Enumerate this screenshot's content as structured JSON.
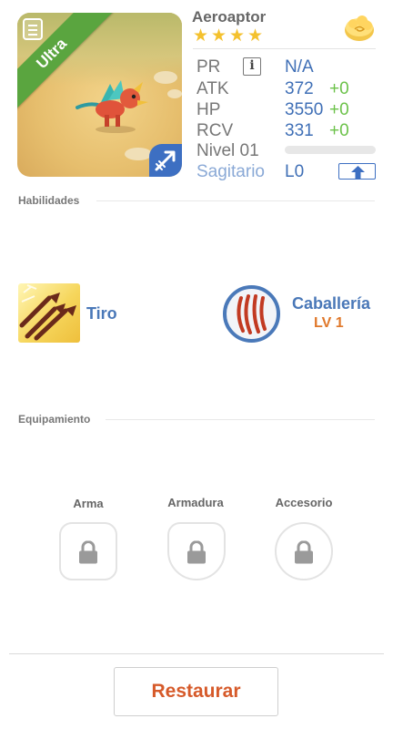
{
  "monster": {
    "name": "Aeroaptor",
    "rarity_badge": "Ultra",
    "stars": 4,
    "element": "Sagitario",
    "element_icon": "arrow-icon"
  },
  "stats": {
    "pr": {
      "label": "PR",
      "value": "N/A"
    },
    "atk": {
      "label": "ATK",
      "value": "372",
      "bonus": "+0"
    },
    "hp": {
      "label": "HP",
      "value": "3550",
      "bonus": "+0"
    },
    "rcv": {
      "label": "RCV",
      "value": "331",
      "bonus": "+0"
    },
    "level": {
      "label": "Nivel 01",
      "progress": 0
    },
    "element_row": {
      "label": "Sagitario",
      "value": "L0"
    }
  },
  "skills": {
    "title": "Habilidades",
    "items": [
      {
        "name": "Tiro",
        "icon": "arrows-skill-icon"
      },
      {
        "name": "Caballería",
        "level": "LV 1",
        "icon": "claw-skill-icon"
      }
    ]
  },
  "equipment": {
    "title": "Equipamiento",
    "slots": [
      {
        "label": "Arma",
        "locked": true
      },
      {
        "label": "Armadura",
        "locked": true
      },
      {
        "label": "Accesorio",
        "locked": true
      }
    ]
  },
  "footer": {
    "restore_label": "Restaurar"
  },
  "colors": {
    "accent_blue": "#3f6fb6",
    "bonus_green": "#6cc24a",
    "restore_orange": "#d65a2a",
    "star_yellow": "#f4c12e",
    "ultra_green": "#5aa53f"
  }
}
